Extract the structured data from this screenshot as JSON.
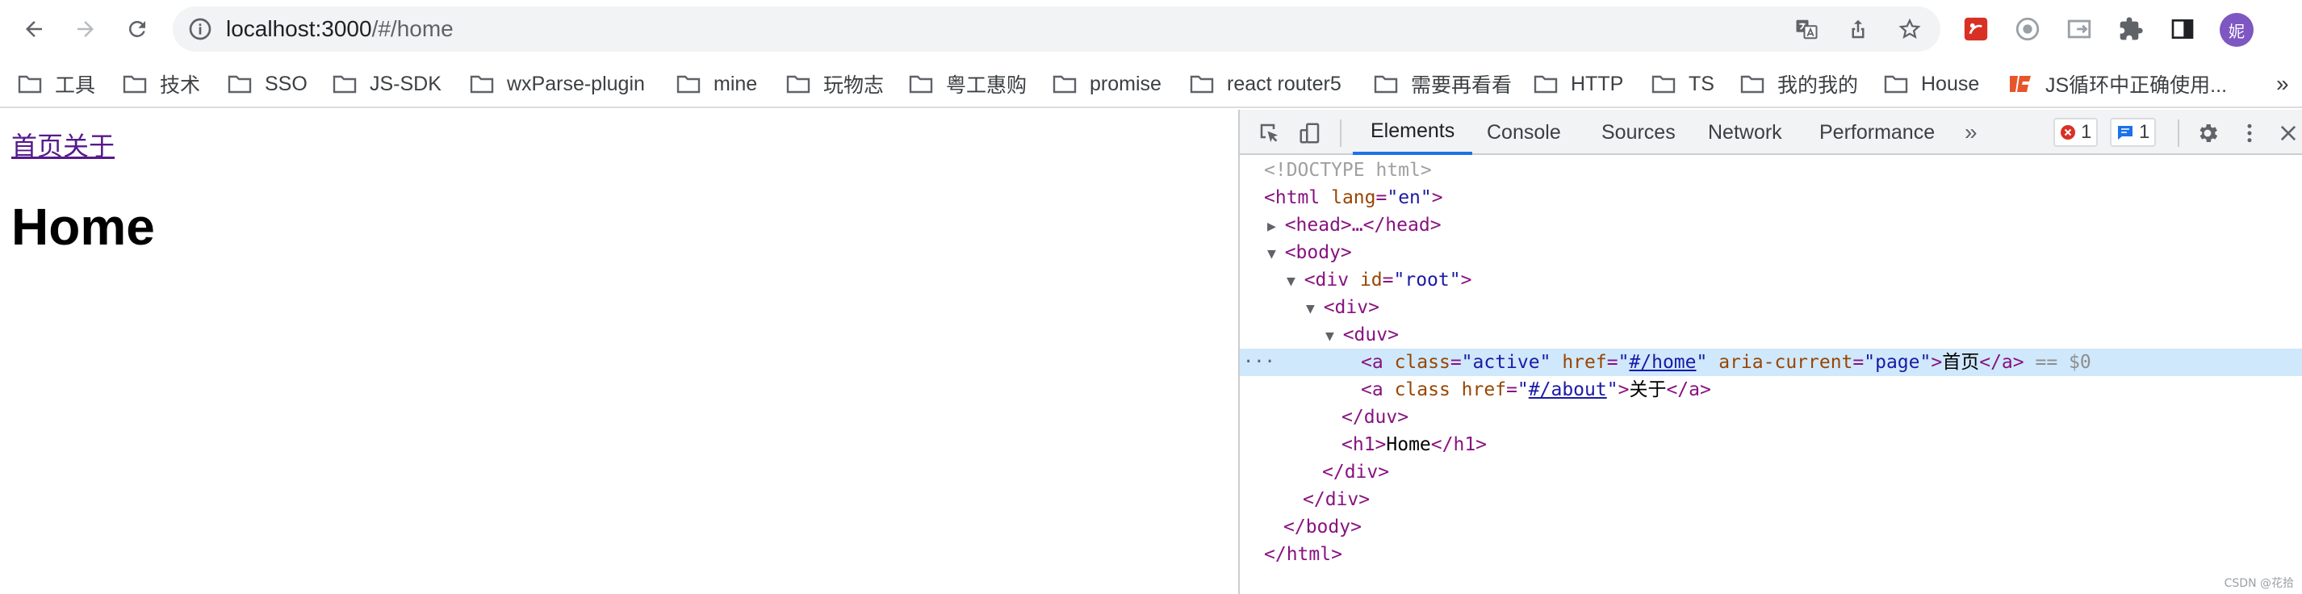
{
  "browser": {
    "url_host": "localhost:3000/#/home",
    "avatar_text": "妮",
    "icons": [
      "back-icon",
      "forward-icon",
      "reload-icon",
      "info-icon",
      "translate-icon",
      "share-icon",
      "star-icon",
      "extension-icon",
      "puzzle-icon",
      "sidebar-icon"
    ]
  },
  "bookmarks": {
    "items": [
      {
        "label": "工具"
      },
      {
        "label": "技术"
      },
      {
        "label": "SSO"
      },
      {
        "label": "JS-SDK"
      },
      {
        "label": "wxParse-plugin"
      },
      {
        "label": "mine"
      },
      {
        "label": "玩物志"
      },
      {
        "label": "粤工惠购"
      },
      {
        "label": "promise"
      },
      {
        "label": "react router5"
      },
      {
        "label": "需要再看看"
      },
      {
        "label": "HTTP"
      },
      {
        "label": "TS"
      },
      {
        "label": "我的我的"
      },
      {
        "label": "House"
      },
      {
        "label": "JS循环中正确使用..."
      }
    ],
    "more": "»"
  },
  "page": {
    "link_home": "首页",
    "link_about": "关于",
    "heading": "Home"
  },
  "devtools": {
    "tabs": [
      "Elements",
      "Console",
      "Sources",
      "Network",
      "Performance"
    ],
    "more_tabs": "»",
    "error_count": "1",
    "message_count": "1",
    "code": {
      "doctype": "<!DOCTYPE html>",
      "html_open": "<html",
      "lang_attr": "lang",
      "lang_val": "\"en\"",
      "head": "<head>…</head>",
      "body_open": "<body>",
      "div_root_open": "<div",
      "id_attr": "id",
      "id_val": "\"root\"",
      "div_open": "<div>",
      "duv_open": "<duv>",
      "a_open": "<a",
      "class_attr": "class",
      "active_val": "\"active\"",
      "href_attr": "href",
      "href_home": "#/home",
      "aria_attr": "aria-current",
      "aria_val": "\"page\"",
      "home_text": "首页",
      "a_close": "</a>",
      "sel_marker": "== $0",
      "href_about": "#/about",
      "about_text": "关于",
      "duv_close": "</duv>",
      "h1_open": "<h1>",
      "h1_text": "Home",
      "h1_close": "</h1>",
      "div_close": "</div>",
      "body_close": "</body>",
      "html_close": "</html>"
    }
  },
  "watermark": "CSDN @花拾"
}
